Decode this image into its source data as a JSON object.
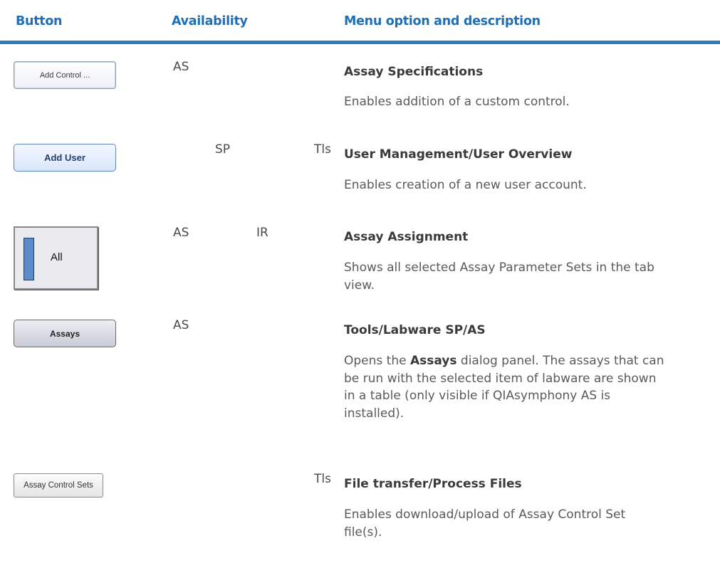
{
  "header": {
    "col_button": "Button",
    "col_availability": "Availability",
    "col_menu": "Menu option and description"
  },
  "rows": [
    {
      "button_label": "Add Control ...",
      "availability": {
        "as": "AS",
        "sp": "",
        "ir": "",
        "tls": ""
      },
      "menu_option": "Assay Specifications",
      "description": "Enables addition of a custom control."
    },
    {
      "button_label": "Add User",
      "availability": {
        "as": "",
        "sp": "SP",
        "ir": "",
        "tls": "Tls"
      },
      "menu_option": "User Management/User Overview",
      "description": "Enables creation of a new user account."
    },
    {
      "button_label": "All",
      "availability": {
        "as": "AS",
        "sp": "",
        "ir": "IR",
        "tls": ""
      },
      "menu_option": "Assay Assignment",
      "description_line1": "Shows all selected Assay Parameter Sets in the tab",
      "description_line2": "view."
    },
    {
      "button_label": "Assays",
      "availability": {
        "as": "AS",
        "sp": "",
        "ir": "",
        "tls": ""
      },
      "menu_option": "Tools/Labware SP/AS",
      "description_pre": "Opens the ",
      "description_bold": "Assays",
      "description_post": " dialog panel. The assays that can",
      "description_line2": "be run with the selected item of labware are shown",
      "description_line3": "in a table (only visible if QIAsymphony AS is",
      "description_line4": "installed)."
    },
    {
      "button_label": "Assay Control Sets",
      "availability": {
        "as": "",
        "sp": "",
        "ir": "",
        "tls": "Tls"
      },
      "menu_option": "File transfer/Process Files",
      "description_line1": "Enables download/upload of Assay Control Set",
      "description_line2": "file(s)."
    }
  ]
}
